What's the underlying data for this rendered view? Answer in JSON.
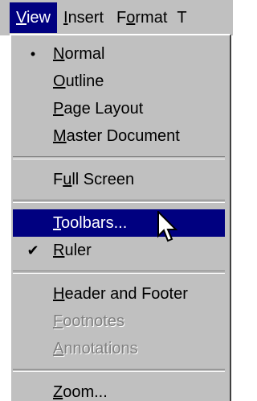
{
  "menubar": {
    "items": [
      {
        "pre": "",
        "acc": "V",
        "post": "iew"
      },
      {
        "pre": "",
        "acc": "I",
        "post": "nsert"
      },
      {
        "pre": "F",
        "acc": "o",
        "post": "rmat"
      }
    ],
    "cut_glyph": "T",
    "active_color": "#000080"
  },
  "menu": {
    "group1": [
      {
        "mark": "•",
        "pre": "",
        "acc": "N",
        "post": "ormal"
      },
      {
        "mark": "",
        "pre": "",
        "acc": "O",
        "post": "utline"
      },
      {
        "mark": "",
        "pre": "",
        "acc": "P",
        "post": "age Layout"
      },
      {
        "mark": "",
        "pre": "",
        "acc": "M",
        "post": "aster Document"
      }
    ],
    "group2": [
      {
        "mark": "",
        "pre": "F",
        "acc": "u",
        "post": "ll Screen"
      }
    ],
    "group3": [
      {
        "mark": "",
        "pre": "",
        "acc": "T",
        "post": "oolbars..."
      },
      {
        "mark": "✔",
        "pre": "",
        "acc": "R",
        "post": "uler"
      }
    ],
    "group4": [
      {
        "mark": "",
        "pre": "",
        "acc": "H",
        "post": "eader and Footer"
      },
      {
        "mark": "",
        "pre": "",
        "acc": "F",
        "post": "ootnotes"
      },
      {
        "mark": "",
        "pre": "",
        "acc": "A",
        "post": "nnotations"
      }
    ],
    "group5": [
      {
        "mark": "",
        "pre": "",
        "acc": "Z",
        "post": "oom..."
      }
    ],
    "highlight_color": "#000080",
    "disabled_color": "#808080"
  },
  "cursor": {
    "icon": "arrow-cursor-icon"
  }
}
